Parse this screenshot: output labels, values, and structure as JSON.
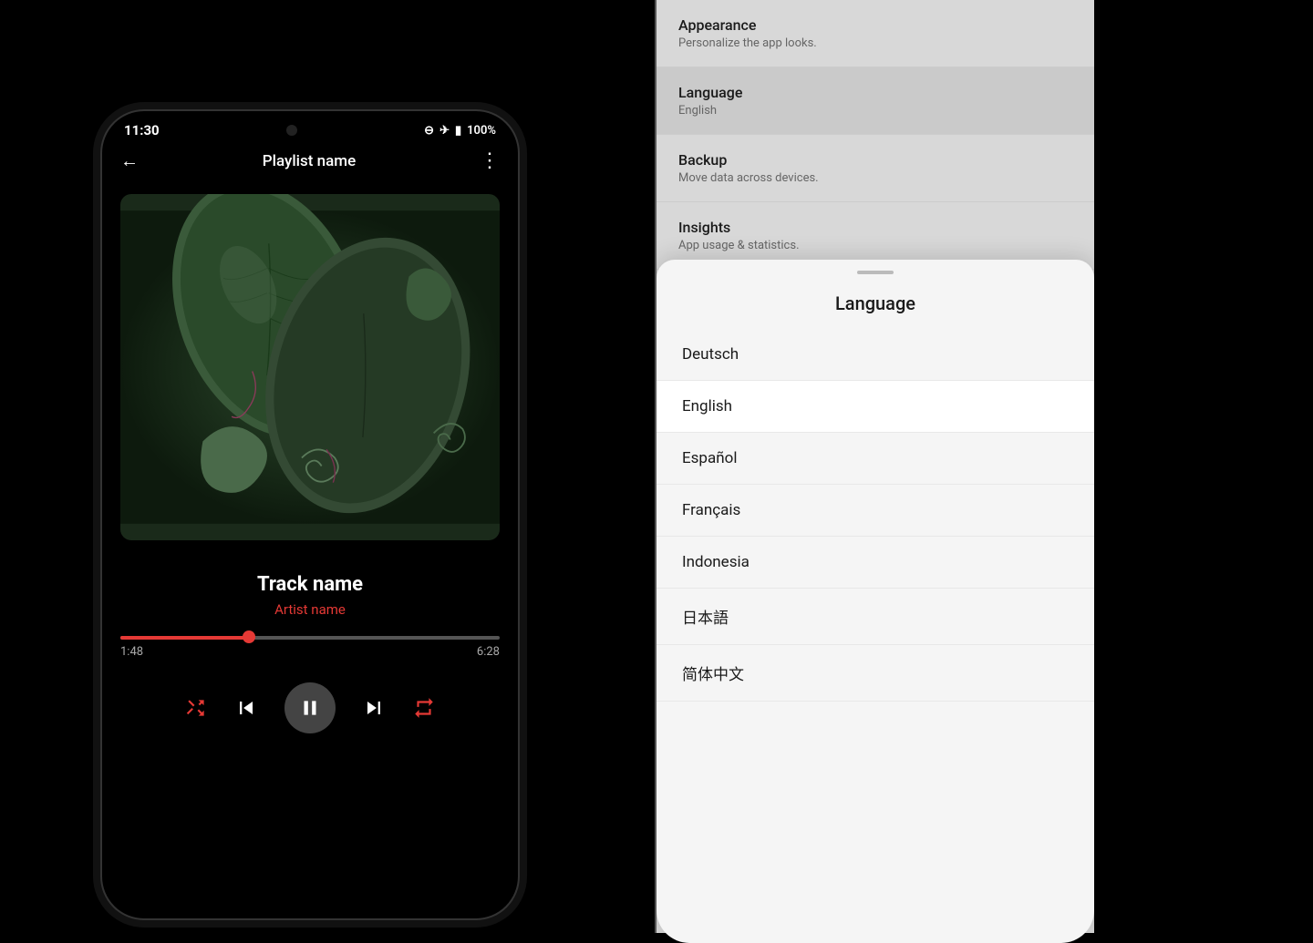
{
  "phone_left": {
    "status": {
      "time": "11:30",
      "icons": "⊖ ✈ 🔋 100%"
    },
    "nav": {
      "back_label": "←",
      "title": "Playlist name",
      "menu_label": "⋮"
    },
    "track": {
      "name": "Track name",
      "artist": "Artist name"
    },
    "progress": {
      "current": "1:48",
      "total": "6:28",
      "fill_percent": 34
    },
    "controls": {
      "shuffle": "shuffle",
      "prev": "skip-prev",
      "play_pause": "pause",
      "next": "skip-next",
      "repeat": "repeat"
    }
  },
  "settings": {
    "items": [
      {
        "title": "Appearance",
        "subtitle": "Personalize the app looks."
      },
      {
        "title": "Language",
        "subtitle": "English"
      },
      {
        "title": "Backup",
        "subtitle": "Move data across devices."
      },
      {
        "title": "Insights",
        "subtitle": "App usage & statistics."
      }
    ]
  },
  "language_sheet": {
    "title": "Language",
    "languages": [
      {
        "label": "Deutsch",
        "active": false
      },
      {
        "label": "English",
        "active": true
      },
      {
        "label": "Español",
        "active": false
      },
      {
        "label": "Français",
        "active": false
      },
      {
        "label": "Indonesia",
        "active": false
      },
      {
        "label": "日本語",
        "active": false
      },
      {
        "label": "简体中文",
        "active": false
      }
    ]
  }
}
